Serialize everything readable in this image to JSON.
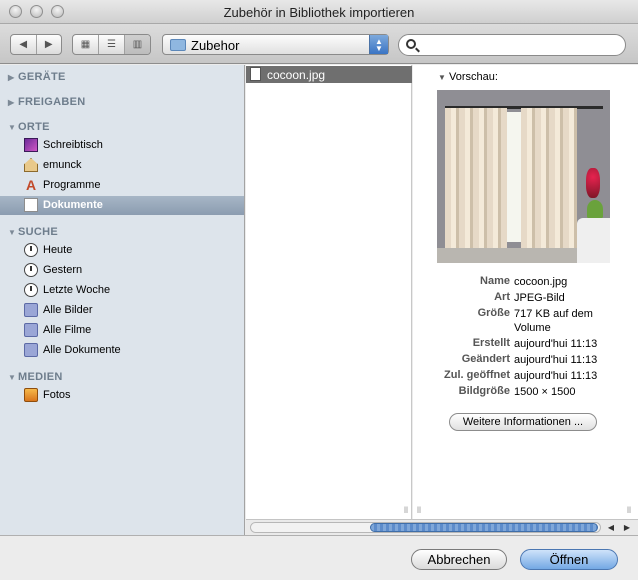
{
  "window": {
    "title": "Zubehör in Bibliothek importieren"
  },
  "toolbar": {
    "back_icon": "chevron-left-icon",
    "forward_icon": "chevron-right-icon",
    "view_icons": [
      "icon-view-icon",
      "list-view-icon",
      "column-view-icon"
    ],
    "location": "Zubehor",
    "search": {
      "value": "",
      "placeholder": ""
    }
  },
  "sidebar": {
    "sections": {
      "devices": "GERÄTE",
      "shared": "FREIGABEN",
      "places": "ORTE",
      "search": "SUCHE",
      "media": "MEDIEN"
    },
    "places": [
      "Schreibtisch",
      "emunck",
      "Programme",
      "Dokumente"
    ],
    "searches": [
      "Heute",
      "Gestern",
      "Letzte Woche",
      "Alle Bilder",
      "Alle Filme",
      "Alle Dokumente"
    ],
    "media": [
      "Fotos"
    ],
    "selected": "Dokumente"
  },
  "files": {
    "selected_file": "cocoon.jpg"
  },
  "preview": {
    "header": "Vorschau:",
    "labels": {
      "name": "Name",
      "kind": "Art",
      "size": "Größe",
      "created": "Erstellt",
      "modified": "Geändert",
      "opened": "Zul. geöffnet",
      "dimensions": "Bildgröße"
    },
    "values": {
      "name": "cocoon.jpg",
      "kind": "JPEG-Bild",
      "size": "717 KB auf dem Volume",
      "created": "aujourd'hui 11:13",
      "modified": "aujourd'hui 11:13",
      "opened": "aujourd'hui 11:13",
      "dimensions": "1500 × 1500"
    },
    "more_info": "Weitere Informationen ..."
  },
  "buttons": {
    "cancel": "Abbrechen",
    "open": "Öffnen"
  }
}
